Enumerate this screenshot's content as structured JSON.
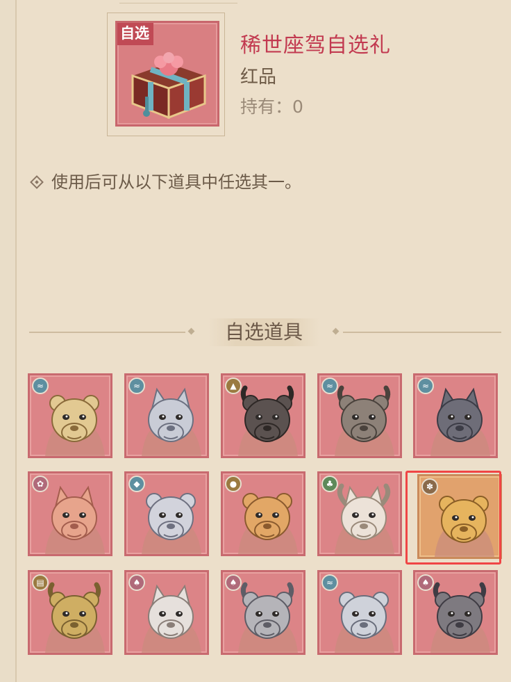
{
  "item": {
    "tag": "自选",
    "name": "稀世座驾自选礼",
    "rarity": "红品",
    "owned": "持有：0"
  },
  "description": "使用后可从以下道具中任选其一。",
  "section_title": "自选道具",
  "colors": {
    "name_red": "#c23a50",
    "tile_pink": "#dc8487",
    "tile_gold": "#e1a26d",
    "selection_red": "#f04545"
  },
  "options": [
    {
      "creature": "sabertooth-tiger",
      "badge_icon": "water-icon",
      "badge_color": "cyan",
      "fur": "#e2c992",
      "shade": "#8a6a3a",
      "horns": false,
      "ears": "round"
    },
    {
      "creature": "grey-wolf",
      "badge_icon": "water-icon",
      "badge_color": "cyan",
      "fur": "#c9ccd6",
      "shade": "#6c7080",
      "horns": false,
      "ears": "pointed"
    },
    {
      "creature": "black-bull",
      "badge_icon": "mountain-icon",
      "badge_color": "gold",
      "fur": "#5b5250",
      "shade": "#2e2826",
      "horns": true,
      "ears": "round"
    },
    {
      "creature": "grey-ox",
      "badge_icon": "water-icon",
      "badge_color": "cyan",
      "fur": "#8d8178",
      "shade": "#4a423c",
      "horns": true,
      "ears": "round"
    },
    {
      "creature": "dark-wolf",
      "badge_icon": "water-icon",
      "badge_color": "cyan",
      "fur": "#6e6d78",
      "shade": "#3c3c46",
      "horns": false,
      "ears": "pointed"
    },
    {
      "creature": "red-fox",
      "badge_icon": "flower-icon",
      "badge_color": "pink",
      "fur": "#e7a48c",
      "shade": "#a35d4d",
      "horns": false,
      "ears": "pointed"
    },
    {
      "creature": "white-bear",
      "badge_icon": "crystal-icon",
      "badge_color": "cyan",
      "fur": "#d2d3dc",
      "shade": "#6e7080",
      "horns": false,
      "ears": "round"
    },
    {
      "creature": "orange-tiger",
      "badge_icon": "fire-icon",
      "badge_color": "gold",
      "fur": "#e2a766",
      "shade": "#8a5a2e",
      "horns": false,
      "ears": "round"
    },
    {
      "creature": "white-deer",
      "badge_icon": "leaf-icon",
      "badge_color": "green",
      "fur": "#ece2d8",
      "shade": "#9a8a7a",
      "horns": true,
      "ears": "pointed"
    },
    {
      "creature": "golden-lion",
      "badge_icon": "paw-icon",
      "badge_color": "brown",
      "fur": "#e6b45e",
      "shade": "#8a5e26",
      "horns": false,
      "ears": "round",
      "selected": true
    },
    {
      "creature": "golden-ram",
      "badge_icon": "scroll-icon",
      "badge_color": "gold",
      "fur": "#cfae63",
      "shade": "#7a6030",
      "horns": true,
      "ears": "round"
    },
    {
      "creature": "white-fox",
      "badge_icon": "flame-icon",
      "badge_color": "pink",
      "fur": "#e6e0dc",
      "shade": "#8a7e78",
      "horns": false,
      "ears": "pointed"
    },
    {
      "creature": "grey-rhino",
      "badge_icon": "flame-icon",
      "badge_color": "pink",
      "fur": "#b5b4b9",
      "shade": "#5e5d66",
      "horns": true,
      "ears": "round"
    },
    {
      "creature": "white-panther",
      "badge_icon": "water-icon",
      "badge_color": "cyan",
      "fur": "#cfd2da",
      "shade": "#6a6e7c",
      "horns": false,
      "ears": "round"
    },
    {
      "creature": "dark-rhino",
      "badge_icon": "flame-icon",
      "badge_color": "pink",
      "fur": "#7e7a80",
      "shade": "#3f3c44",
      "horns": true,
      "ears": "round"
    }
  ]
}
